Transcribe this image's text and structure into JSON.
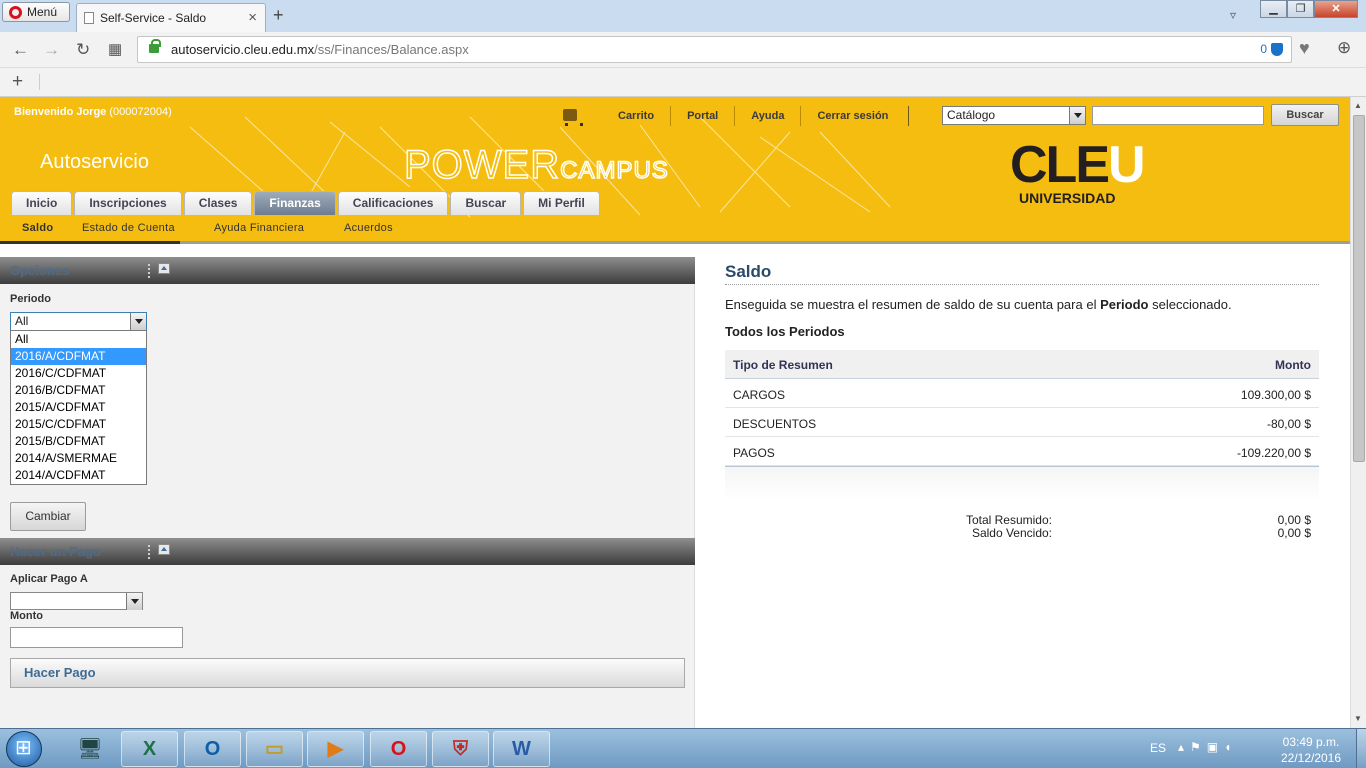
{
  "browser": {
    "menu_label": "Menú",
    "tab_title": "Self-Service - Saldo",
    "url_host": "autoservicio.cleu.edu.mx",
    "url_path": "/ss/Finances/Balance.aspx",
    "shield_count": "0"
  },
  "header": {
    "welcome": "Bienvenido Jorge",
    "user_id": "(000072004)",
    "links": [
      "Carrito",
      "Portal",
      "Ayuda",
      "Cerrar sesión"
    ],
    "catalog_value": "Catálogo",
    "search_button": "Buscar",
    "brand_autoservicio": "Autoservicio",
    "brand_power": "POWER",
    "brand_campus": "CAMPUS",
    "logo_main": "CLE",
    "logo_u": "U",
    "logo_sub": "UNIVERSIDAD"
  },
  "nav": {
    "tabs": [
      "Inicio",
      "Inscripciones",
      "Clases",
      "Finanzas",
      "Calificaciones",
      "Buscar",
      "Mi Perfil"
    ],
    "active_tab": "Finanzas",
    "subtabs": [
      "Saldo",
      "Estado de Cuenta",
      "Ayuda Financiera",
      "Acuerdos"
    ],
    "active_subtab": "Saldo"
  },
  "options": {
    "title": "Opciones",
    "periodo_label": "Periodo",
    "periodo_value": "All",
    "periodo_options": [
      "All",
      "2016/A/CDFMAT",
      "2016/C/CDFMAT",
      "2016/B/CDFMAT",
      "2015/A/CDFMAT",
      "2015/C/CDFMAT",
      "2015/B/CDFMAT",
      "2014/A/SMERMAE",
      "2014/A/CDFMAT"
    ],
    "highlighted_option": "2016/A/CDFMAT",
    "cambiar_button": "Cambiar"
  },
  "payment": {
    "title": "Hacer un Pago",
    "aplicar_label": "Aplicar Pago A",
    "monto_label": "Monto",
    "hacer_pago_button": "Hacer Pago"
  },
  "balance": {
    "title": "Saldo",
    "intro_pre": "Enseguida se muestra el resumen de saldo de su cuenta para el ",
    "intro_bold": "Periodo",
    "intro_post": " seleccionado.",
    "subtitle": "Todos los Periodos",
    "col_tipo": "Tipo de Resumen",
    "col_monto": "Monto",
    "rows": [
      {
        "tipo": "CARGOS",
        "monto": "109.300,00 $"
      },
      {
        "tipo": "DESCUENTOS",
        "monto": "-80,00 $"
      },
      {
        "tipo": "PAGOS",
        "monto": "-109.220,00 $"
      }
    ],
    "total_label": "Total Resumido:",
    "total_value": "0,00 $",
    "vencido_label": "Saldo Vencido:",
    "vencido_value": "0,00 $"
  },
  "taskbar": {
    "language": "ES",
    "time": "03:49 p.m.",
    "date": "22/12/2016",
    "apps": [
      "windows-explorer",
      "excel",
      "outlook",
      "file-explorer",
      "media-player",
      "opera",
      "security",
      "word"
    ]
  }
}
